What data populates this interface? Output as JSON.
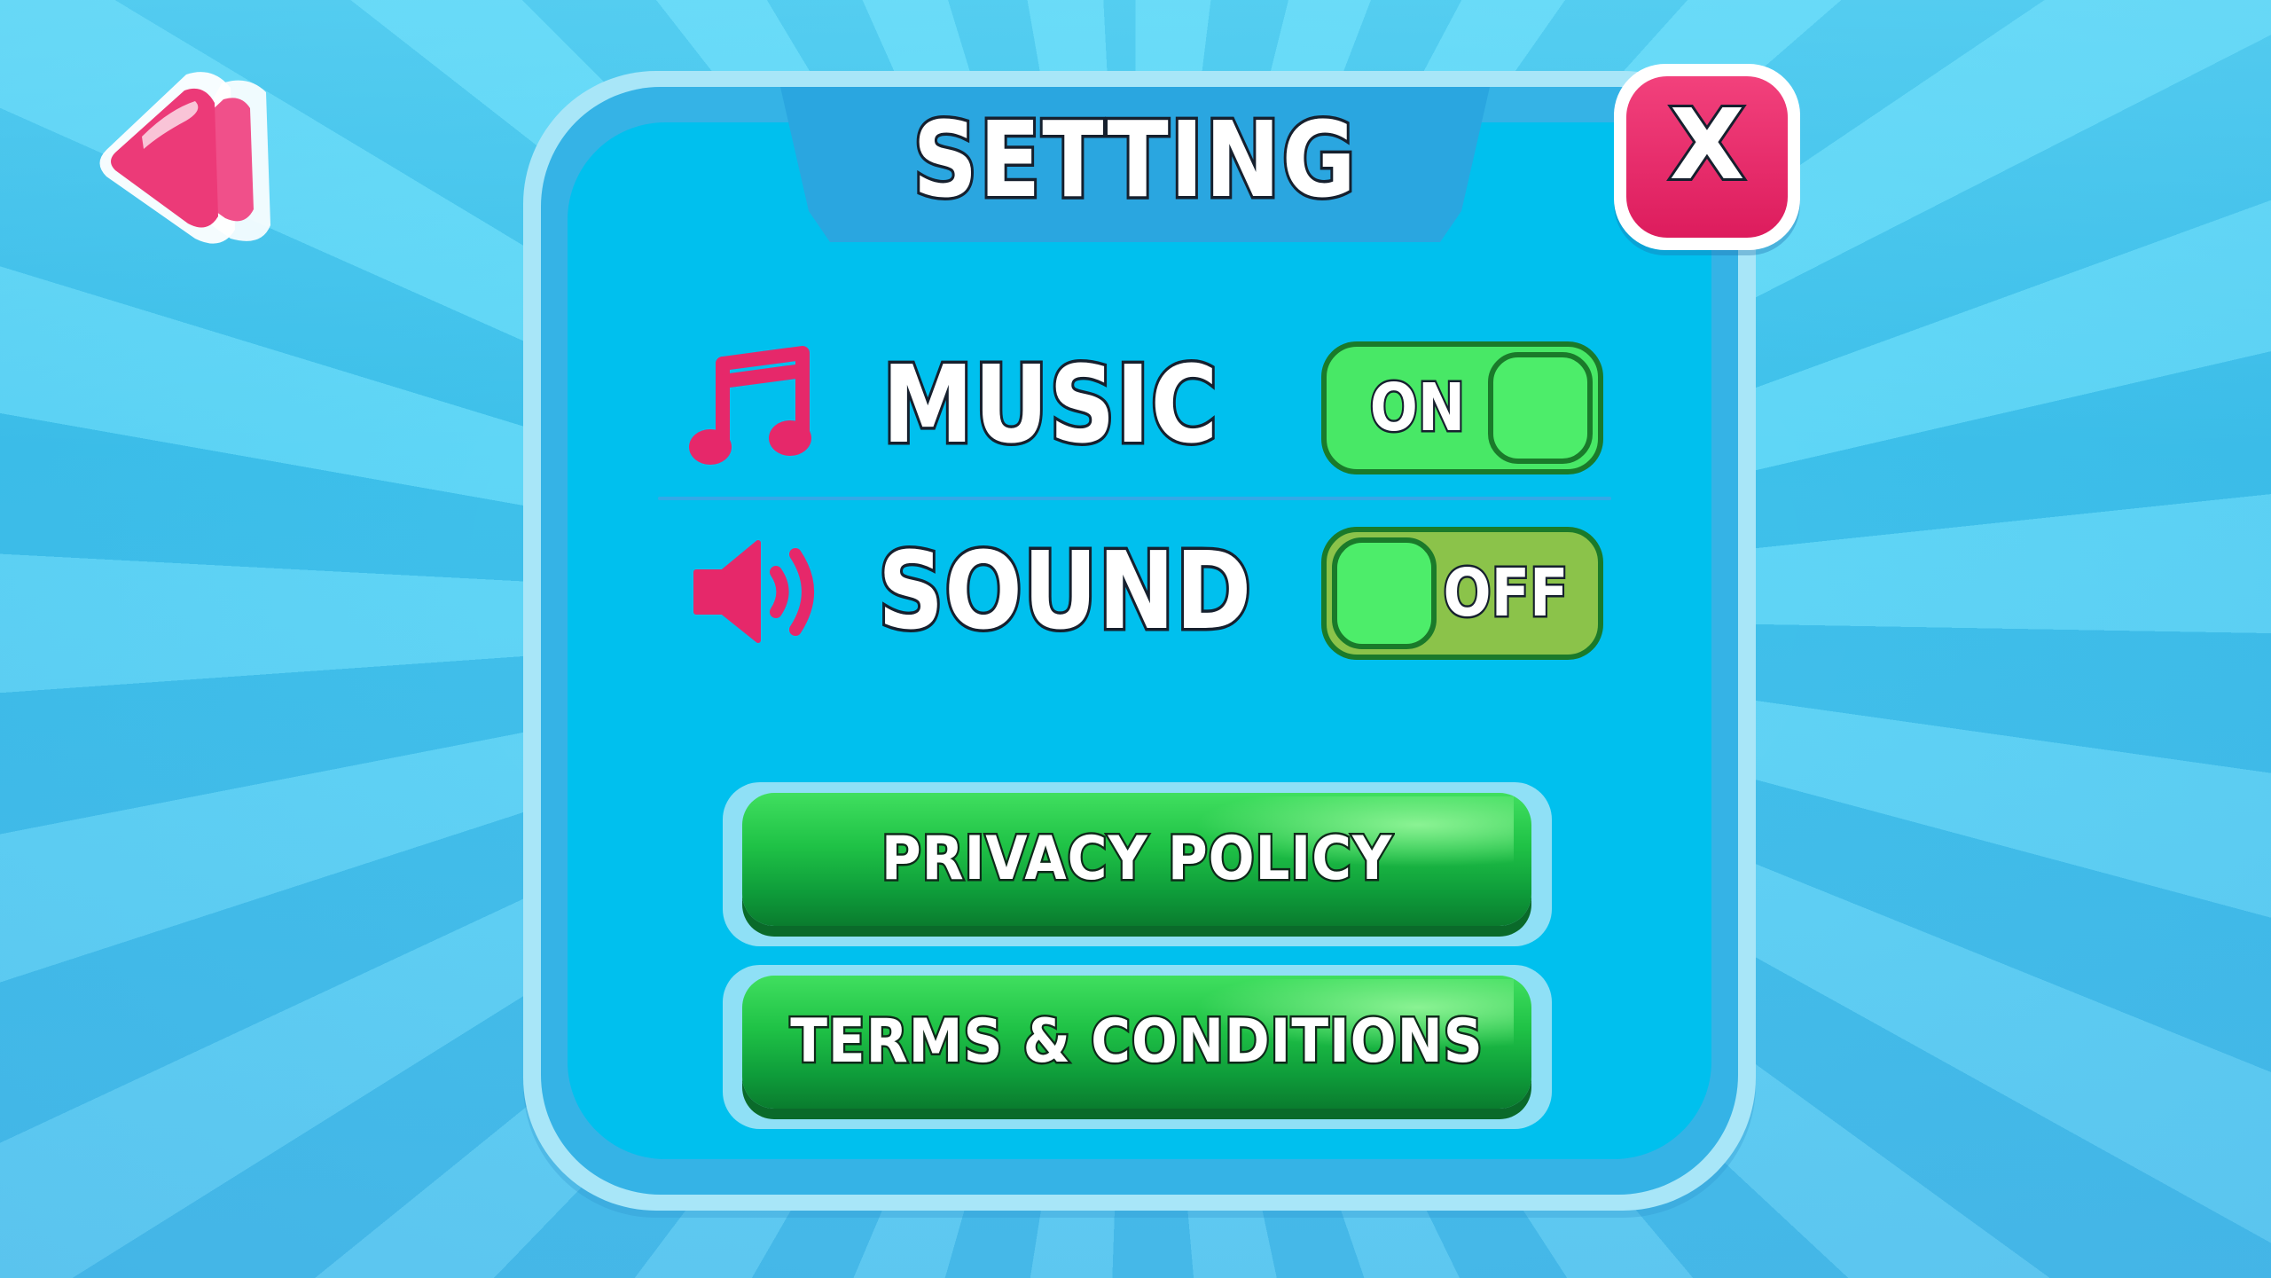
{
  "header": {
    "title": "SETTING",
    "close_label": "X"
  },
  "settings": [
    {
      "key": "music",
      "label": "MUSIC",
      "icon": "music-note-icon",
      "state": "ON"
    },
    {
      "key": "sound",
      "label": "SOUND",
      "icon": "speaker-icon",
      "state": "OFF"
    }
  ],
  "buttons": {
    "privacy": "PRIVACY POLICY",
    "terms": "TERMS & CONDITIONS"
  },
  "colors": {
    "background": "#45c8ee",
    "panel": "#00c0ee",
    "accent_pink": "#e6286a",
    "toggle_green": "#48e866",
    "button_green": "#1fc246"
  }
}
